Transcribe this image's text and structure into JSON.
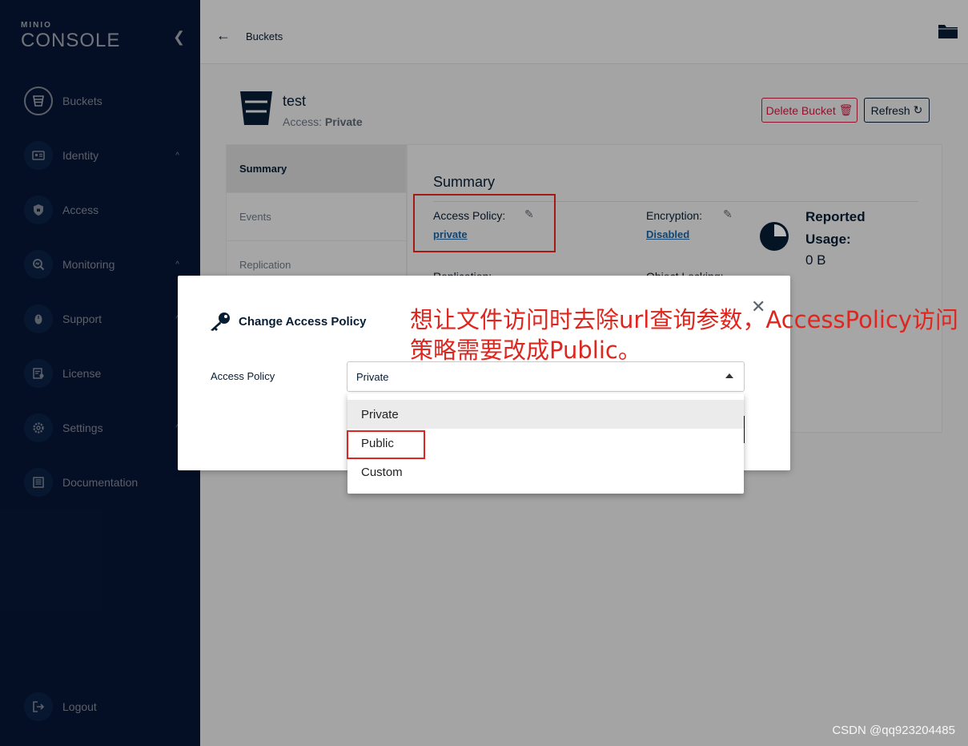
{
  "sidebar": {
    "brand": "MINIO",
    "product": "CONSOLE",
    "items": [
      {
        "label": "Buckets",
        "icon": "bucket-icon",
        "active": true,
        "expandable": false
      },
      {
        "label": "Identity",
        "icon": "identity-icon",
        "active": false,
        "expandable": true
      },
      {
        "label": "Access",
        "icon": "shield-icon",
        "active": false,
        "expandable": false
      },
      {
        "label": "Monitoring",
        "icon": "monitoring-icon",
        "active": false,
        "expandable": true
      },
      {
        "label": "Support",
        "icon": "support-icon",
        "active": false,
        "expandable": true
      },
      {
        "label": "License",
        "icon": "license-icon",
        "active": false,
        "expandable": false
      },
      {
        "label": "Settings",
        "icon": "gear-icon",
        "active": false,
        "expandable": true
      },
      {
        "label": "Documentation",
        "icon": "documentation-icon",
        "active": false,
        "expandable": false
      }
    ],
    "logout_label": "Logout"
  },
  "topbar": {
    "breadcrumb": "Buckets"
  },
  "bucket": {
    "name": "test",
    "access_label": "Access:",
    "access_value": "Private",
    "delete_label": "Delete Bucket",
    "refresh_label": "Refresh"
  },
  "tabs": [
    "Summary",
    "Events",
    "Replication"
  ],
  "summary": {
    "title": "Summary",
    "access_policy_label": "Access Policy:",
    "access_policy_value": "private",
    "encryption_label": "Encryption:",
    "encryption_value": "Disabled",
    "usage_title": "Reported Usage:",
    "usage_value": "0 B",
    "replication_label": "Replication:",
    "object_locking_label": "Object Locking:"
  },
  "modal": {
    "title": "Change Access Policy",
    "field_label": "Access Policy",
    "selected": "Private",
    "options": [
      "Private",
      "Public",
      "Custom"
    ]
  },
  "annotation": "想让文件访问时去除url查询参数，AccessPolicy访问策略需要改成Public。",
  "watermark": "CSDN @qq923204485",
  "colors": {
    "sidebar_bg": "#081c42",
    "accent_red": "#e0251e",
    "delete_red": "#c51b3f",
    "text_dark": "#071d33",
    "link_blue": "#1c5f9c"
  }
}
